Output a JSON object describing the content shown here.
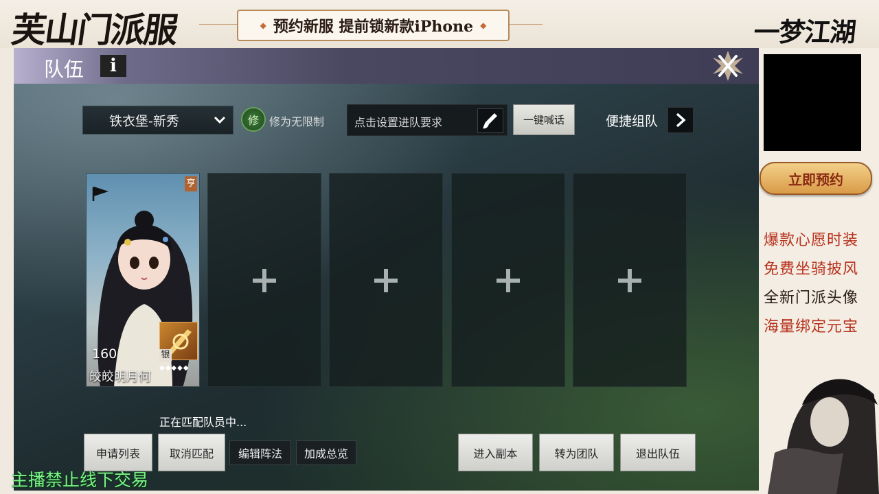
{
  "overlay": {
    "brand_left": "芙山门派服",
    "promo": "预约新服 提前锁新款iPhone",
    "brand_right": "一梦江湖",
    "reserve_button": "立即预约",
    "perks": [
      "爆款心愿时装",
      "免费坐骑披风",
      "全新门派头像",
      "海量绑定元宝"
    ],
    "stream_notice": "主播禁止线下交易",
    "colors": {
      "perk_red": "#b8321e",
      "notice_green": "#7cf28a"
    }
  },
  "window": {
    "title": "队伍",
    "info_icon": "i",
    "close_icon": "close-icon"
  },
  "toolbar": {
    "server_select": "铁衣堡-新秀",
    "cultivation_icon_char": "修",
    "cultivation_text": "修为无限制",
    "requirement_placeholder": "点击设置进队要求",
    "shout_button": "一键喊话",
    "quick_team_label": "便捷组队"
  },
  "team": {
    "members": [
      {
        "name": "皎皎明月何",
        "level": "160",
        "badge": "亨",
        "rank_tag": "银",
        "stars": "◆◆◆◆◆",
        "is_leader": true
      }
    ],
    "empty_slots": 4
  },
  "status": {
    "matching_text": "正在匹配队员中..."
  },
  "actions": {
    "apply_list": "申请列表",
    "cancel_match": "取消匹配",
    "edit_formation": "编辑阵法",
    "bonus_overview": "加成总览",
    "enter_dungeon": "进入副本",
    "convert_to_raid": "转为团队",
    "leave_team": "退出队伍"
  }
}
